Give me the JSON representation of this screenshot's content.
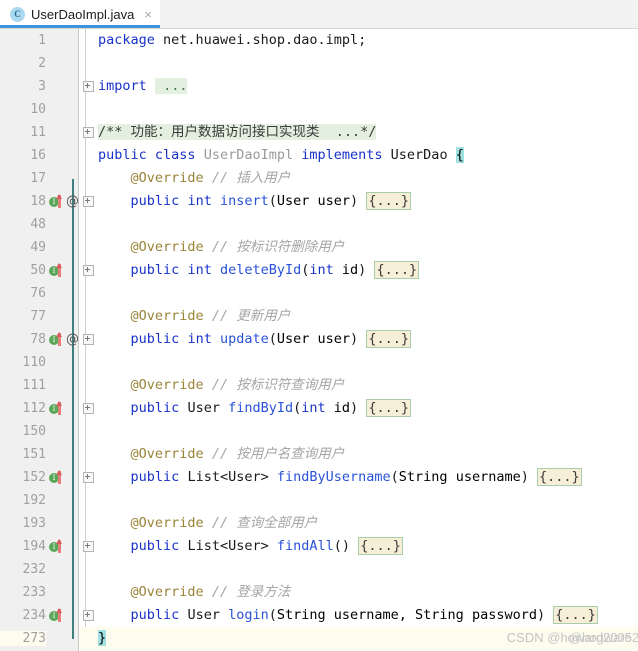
{
  "tab": {
    "icon": "java-class-icon",
    "icon_letter": "C",
    "title": "UserDaoImpl.java",
    "close_glyph": "×"
  },
  "editor": {
    "at_glyph": "@",
    "impl_letter": "I",
    "rows": [
      {
        "lineno": "1",
        "icons": [],
        "fold": false,
        "current": false,
        "code": "package net.huawei.shop.dao.impl;",
        "kind": "package"
      },
      {
        "lineno": "2",
        "icons": [],
        "fold": false,
        "current": false,
        "code": "",
        "kind": "blank"
      },
      {
        "lineno": "3",
        "icons": [],
        "fold": true,
        "current": false,
        "code": "import ...",
        "kind": "import"
      },
      {
        "lineno": "10",
        "icons": [],
        "fold": false,
        "current": false,
        "code": "",
        "kind": "blank"
      },
      {
        "lineno": "11",
        "icons": [],
        "fold": true,
        "current": false,
        "code": "/** 功能：用户数据访问接口实现类  ...*/",
        "kind": "javadoc"
      },
      {
        "lineno": "16",
        "icons": [],
        "fold": false,
        "current": false,
        "code": "public class UserDaoImpl implements UserDao {",
        "kind": "classdecl"
      },
      {
        "lineno": "17",
        "icons": [],
        "fold": false,
        "current": false,
        "code": "    @Override // 插入用户",
        "kind": "annotation"
      },
      {
        "lineno": "18",
        "icons": [
          "impl",
          "at"
        ],
        "fold": true,
        "current": false,
        "code": "    public int insert(User user) {...}",
        "kind": "method",
        "ret": "int",
        "name": "insert",
        "params": "User user"
      },
      {
        "lineno": "48",
        "icons": [],
        "fold": false,
        "current": false,
        "code": "",
        "kind": "blank"
      },
      {
        "lineno": "49",
        "icons": [],
        "fold": false,
        "current": false,
        "code": "    @Override // 按标识符删除用户",
        "kind": "annotation"
      },
      {
        "lineno": "50",
        "icons": [
          "impl"
        ],
        "fold": true,
        "current": false,
        "code": "    public int deleteById(int id) {...}",
        "kind": "method",
        "ret": "int",
        "name": "deleteById",
        "params": "int id"
      },
      {
        "lineno": "76",
        "icons": [],
        "fold": false,
        "current": false,
        "code": "",
        "kind": "blank"
      },
      {
        "lineno": "77",
        "icons": [],
        "fold": false,
        "current": false,
        "code": "    @Override // 更新用户",
        "kind": "annotation"
      },
      {
        "lineno": "78",
        "icons": [
          "impl",
          "at"
        ],
        "fold": true,
        "current": false,
        "code": "    public int update(User user) {...}",
        "kind": "method",
        "ret": "int",
        "name": "update",
        "params": "User user"
      },
      {
        "lineno": "110",
        "icons": [],
        "fold": false,
        "current": false,
        "code": "",
        "kind": "blank"
      },
      {
        "lineno": "111",
        "icons": [],
        "fold": false,
        "current": false,
        "code": "    @Override // 按标识符查询用户",
        "kind": "annotation"
      },
      {
        "lineno": "112",
        "icons": [
          "impl"
        ],
        "fold": true,
        "current": false,
        "code": "    public User findById(int id) {...}",
        "kind": "method",
        "ret": "User",
        "name": "findById",
        "params": "int id"
      },
      {
        "lineno": "150",
        "icons": [],
        "fold": false,
        "current": false,
        "code": "",
        "kind": "blank"
      },
      {
        "lineno": "151",
        "icons": [],
        "fold": false,
        "current": false,
        "code": "    @Override // 按用户名查询用户",
        "kind": "annotation"
      },
      {
        "lineno": "152",
        "icons": [
          "impl"
        ],
        "fold": true,
        "current": false,
        "code": "    public List<User> findByUsername(String username) {...}",
        "kind": "method",
        "ret": "List<User>",
        "name": "findByUsername",
        "params": "String username"
      },
      {
        "lineno": "192",
        "icons": [],
        "fold": false,
        "current": false,
        "code": "",
        "kind": "blank"
      },
      {
        "lineno": "193",
        "icons": [],
        "fold": false,
        "current": false,
        "code": "    @Override // 查询全部用户",
        "kind": "annotation"
      },
      {
        "lineno": "194",
        "icons": [
          "impl"
        ],
        "fold": true,
        "current": false,
        "code": "    public List<User> findAll() {...}",
        "kind": "method",
        "ret": "List<User>",
        "name": "findAll",
        "params": ""
      },
      {
        "lineno": "232",
        "icons": [],
        "fold": false,
        "current": false,
        "code": "",
        "kind": "blank"
      },
      {
        "lineno": "233",
        "icons": [],
        "fold": false,
        "current": false,
        "code": "    @Override // 登录方法",
        "kind": "annotation"
      },
      {
        "lineno": "234",
        "icons": [
          "impl"
        ],
        "fold": true,
        "current": false,
        "code": "    public User login(String username, String password) {...}",
        "kind": "method",
        "ret": "User",
        "name": "login",
        "params": "String username, String password"
      },
      {
        "lineno": "273",
        "icons": [],
        "fold": false,
        "current": true,
        "code": "}",
        "kind": "closebrace"
      }
    ]
  },
  "watermark": {
    "text_primary": "CSDN @howard2005",
    "text_overlay": "@hogware2005"
  },
  "colors": {
    "keyword": "#1932c9",
    "method": "#2a52d8",
    "annotation": "#9a8438",
    "comment": "#a5a5a5",
    "fold_body_bg": "#f6eed6",
    "fold_body_border": "#a8cfa8",
    "fold_green_bg": "#e3f0e0",
    "brace_match_bg": "#9fe0e0",
    "current_line_bg": "#fdfcef",
    "gutter_bg": "#f0f0f0",
    "tab_accent": "#3d93de"
  }
}
